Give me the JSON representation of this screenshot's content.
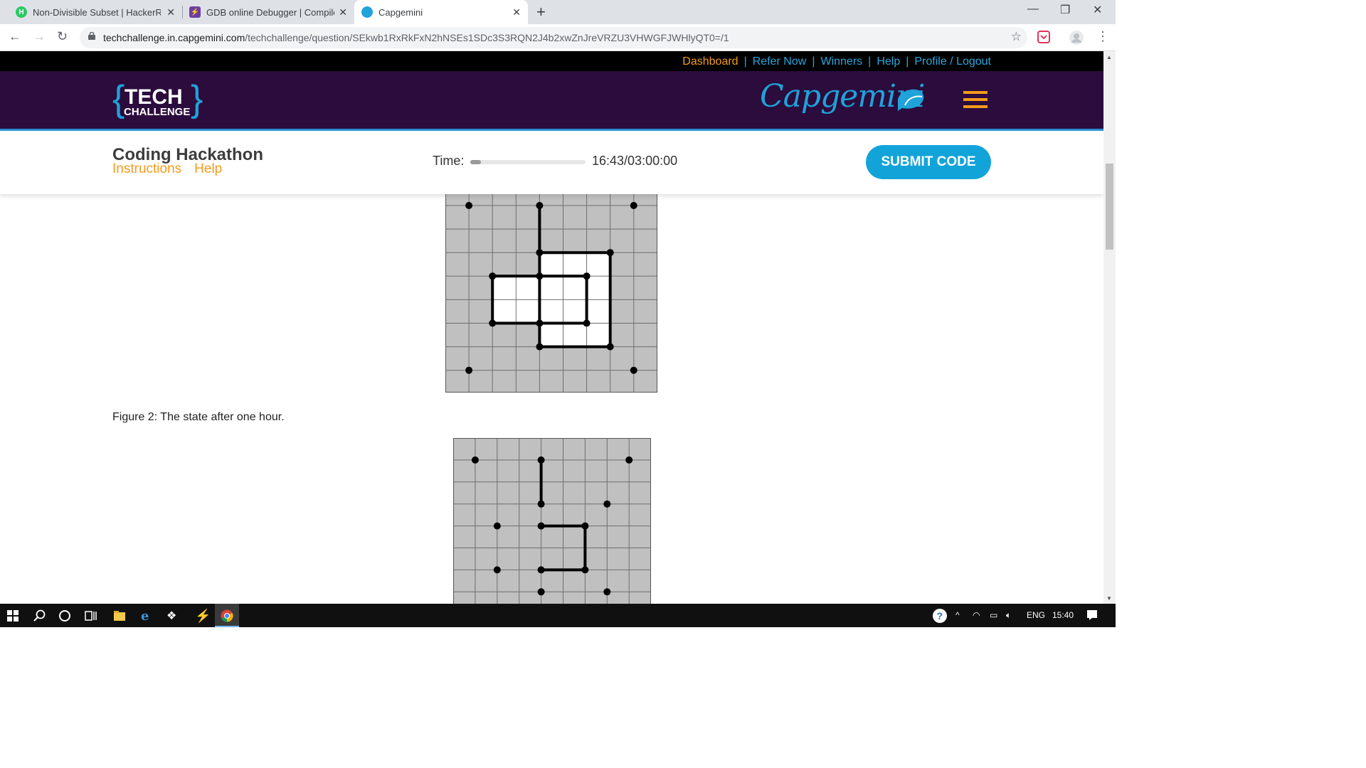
{
  "browser": {
    "tabs": [
      {
        "title": "Non-Divisible Subset | HackerRan",
        "icon": "hackerrank-icon",
        "color": "#2ec866"
      },
      {
        "title": "GDB online Debugger | Compiler",
        "icon": "gdb-icon",
        "color": "#6b3fa0"
      },
      {
        "title": "Capgemini",
        "icon": "capgemini-icon",
        "color": "#1fa3d9"
      }
    ],
    "url_host": "techchallenge.in.capgemini.com",
    "url_path": "/techchallenge/question/SEkwb1RxRkFxN2hNSEs1SDc3S3RQN2J4b2xwZnJreVRZU3VHWGFJWHlyQT0=/1"
  },
  "toplinks": {
    "dashboard": "Dashboard",
    "refer": "Refer Now",
    "winners": "Winners",
    "help": "Help",
    "profile": "Profile / Logout",
    "sep": "|"
  },
  "banner": {
    "logo_top": "TECH",
    "logo_bottom": "CHALLENGE",
    "brand": "Capgemini"
  },
  "header": {
    "title": "Coding Hackathon",
    "instructions": "Instructions",
    "help": "Help",
    "time_label": "Time:",
    "time_value": "16:43/03:00:00",
    "progress_fraction": 0.093,
    "submit": "SUBMIT CODE"
  },
  "content": {
    "caption": "Figure 2: The state after one hour."
  },
  "taskbar": {
    "lang": "ENG",
    "clock": "15:40"
  },
  "colors": {
    "accent": "#12a4d9",
    "orange": "#f59b1a",
    "banner": "#2b0c3d"
  }
}
